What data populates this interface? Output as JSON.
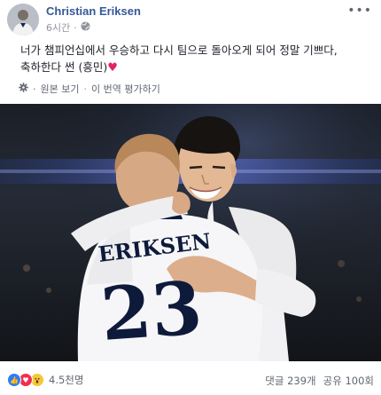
{
  "post": {
    "author": "Christian Eriksen",
    "time": "6시간",
    "line1": "너가 챔피언십에서 우승하고 다시 팀으로 돌아오게 되어 정말 기쁘다,",
    "line2": "축하한다 썬 (흥민)",
    "see_original": "원본 보기",
    "separator": "·",
    "rate_translation": "이 번역 평가하기"
  },
  "photo": {
    "jersey_name": "ERIKSEN",
    "jersey_number": "23"
  },
  "footer": {
    "reaction_count": "4.5천명",
    "comments": "댓글 239개",
    "shares": "공유 100회"
  },
  "icons": {
    "privacy": "globe-icon",
    "more": "more-options-icon",
    "settings": "gear-icon",
    "reactions": [
      "like-icon",
      "love-icon",
      "wow-icon"
    ]
  },
  "colors": {
    "author": "#365899",
    "heart": "#e0245e",
    "like": "#2f7cf6",
    "love": "#f0304e",
    "wow": "#f7c63a"
  }
}
